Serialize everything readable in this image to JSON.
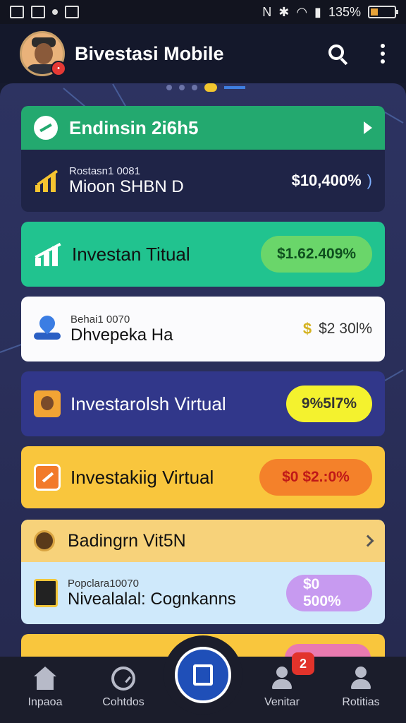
{
  "status_bar": {
    "battery_text": "135%",
    "icons": [
      "gallery-icon",
      "photo-icon",
      "dot-icon",
      "chart-icon",
      "nfc-icon",
      "bluetooth-icon",
      "wifi-icon",
      "signal-icon",
      "battery-icon"
    ]
  },
  "header": {
    "title": "Bivestasi Mobile",
    "avatar_badge": "•"
  },
  "cards": {
    "c1": {
      "header": "Endinsin 2i6h5",
      "item_sub": "Rostasn1 0081",
      "item_title": "Mioon SHBN D",
      "amount": "$10,400%",
      "amount_suffix": ")"
    },
    "c2": {
      "label": "Investan Titual",
      "amount": "$1.62.409%"
    },
    "c3": {
      "item_sub": "Behai1 0070",
      "item_title": "Dhvepeka Ha",
      "dollar": "$",
      "amount": "$2 30l%"
    },
    "c4": {
      "label": "Investarolsh Virtual",
      "amount": "9%5l7%"
    },
    "c5": {
      "label": "Investakiig Virtual",
      "amount": "$0 $2.:0%"
    },
    "c6": {
      "header": "Badingrn Vit5N",
      "item_sub": "Popclara10070",
      "item_title": "Nivealalal: Cognkanns",
      "amount": "$0 500%"
    }
  },
  "nav": {
    "items": [
      {
        "label": "Inpaoa",
        "icon": "home-icon"
      },
      {
        "label": "Cohtdos",
        "icon": "gauge-icon"
      },
      {
        "label": "",
        "icon": "square-icon"
      },
      {
        "label": "Venitar",
        "icon": "person-icon"
      },
      {
        "label": "Rotitias",
        "icon": "person-icon"
      }
    ],
    "badge": "2"
  },
  "colors": {
    "accent_green": "#21c38f",
    "header_green": "#23a96f",
    "accent_yellow": "#f9c63d",
    "panel": "#2d3361",
    "fab": "#1f4fb8"
  }
}
